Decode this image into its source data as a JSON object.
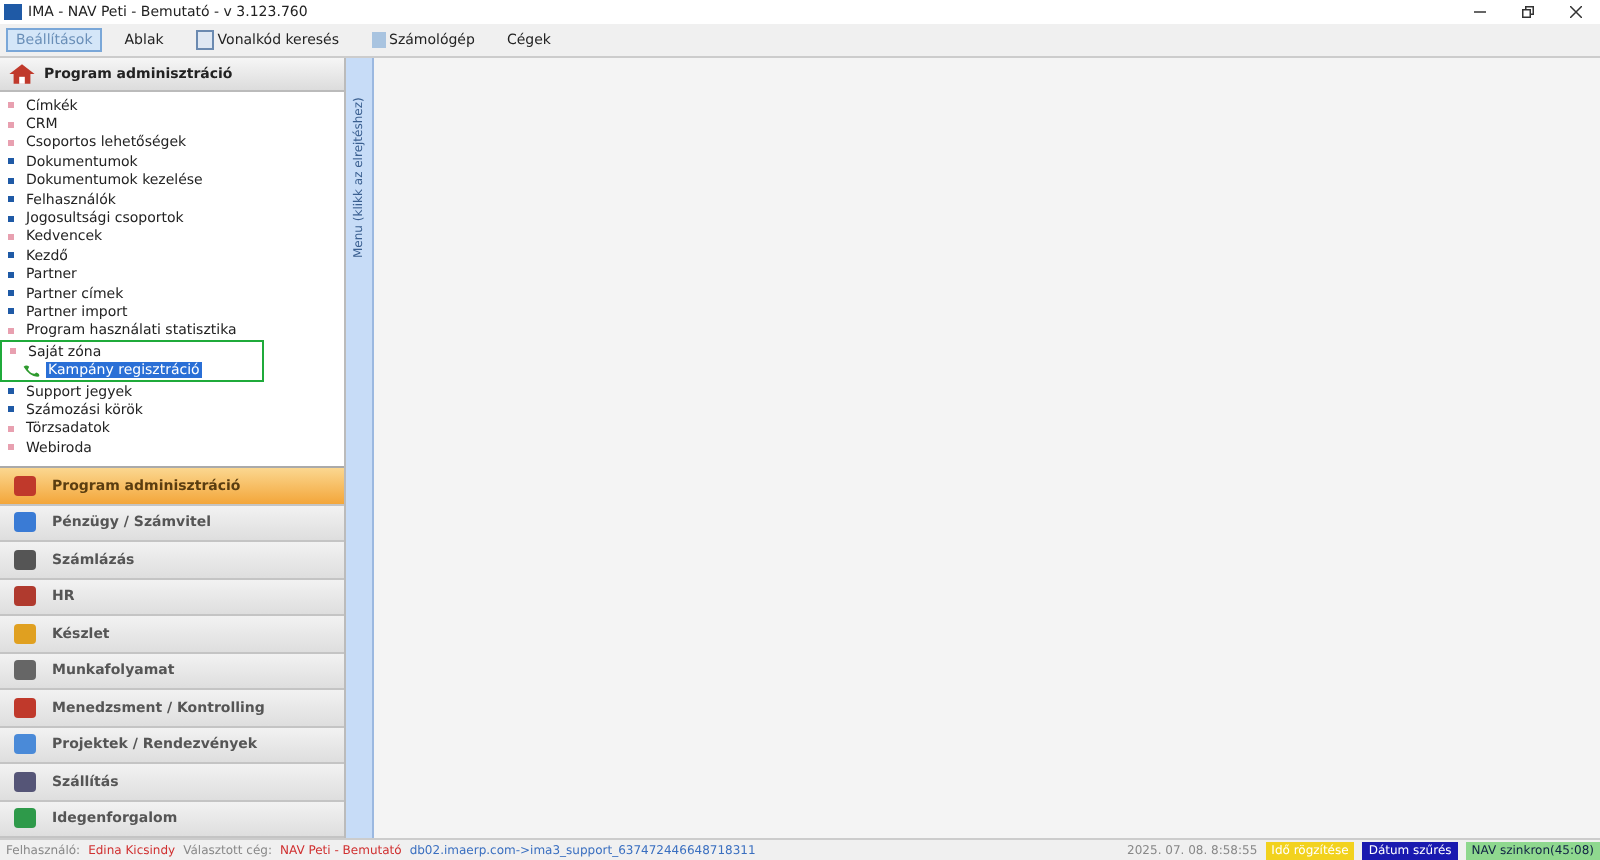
{
  "window": {
    "title": "IMA - NAV Peti - Bemutató - v 3.123.760"
  },
  "menu": [
    {
      "label": "Beállítások",
      "selected": true
    },
    {
      "label": "Ablak",
      "selected": false
    },
    {
      "label": "Vonalkód keresés",
      "selected": false
    },
    {
      "label": "Számológép",
      "selected": false
    },
    {
      "label": "Cégek",
      "selected": false
    }
  ],
  "panel": {
    "title": "Program adminisztráció",
    "collapse_label": "Menu (klikk az elrejtéshez)"
  },
  "tree": [
    {
      "label": "Címkék",
      "color": "#e8a0b0",
      "selected": false
    },
    {
      "label": "CRM",
      "color": "#e8a0b0",
      "selected": false
    },
    {
      "label": "Csoportos lehetőségek",
      "color": "#e8a0b0",
      "selected": false
    },
    {
      "label": "Dokumentumok",
      "color": "#1f5aa6",
      "selected": false
    },
    {
      "label": "Dokumentumok kezelése",
      "color": "#1f5aa6",
      "selected": false
    },
    {
      "label": "Felhasználók",
      "color": "#1f5aa6",
      "selected": false
    },
    {
      "label": "Jogosultsági csoportok",
      "color": "#1f5aa6",
      "selected": false
    },
    {
      "label": "Kedvencek",
      "color": "#e8a0b0",
      "selected": false
    },
    {
      "label": "Kezdő",
      "color": "#1f5aa6",
      "selected": false
    },
    {
      "label": "Partner",
      "color": "#1f5aa6",
      "selected": false
    },
    {
      "label": "Partner címek",
      "color": "#1f5aa6",
      "selected": false
    },
    {
      "label": "Partner import",
      "color": "#1f5aa6",
      "selected": false
    },
    {
      "label": "Program használati statisztika",
      "color": "#e8a0b0",
      "selected": false
    },
    {
      "label": "Saját zóna",
      "color": "#e8a0b0",
      "selected": false,
      "children": [
        {
          "label": "Kampány regisztráció",
          "selected": true
        }
      ]
    },
    {
      "label": "Support jegyek",
      "color": "#1f5aa6",
      "selected": false
    },
    {
      "label": "Számozási körök",
      "color": "#1f5aa6",
      "selected": false
    },
    {
      "label": "Törzsadatok",
      "color": "#e8a0b0",
      "selected": false
    },
    {
      "label": "Webiroda",
      "color": "#e8a0b0",
      "selected": false
    }
  ],
  "modules": [
    {
      "label": "Program adminisztráció",
      "selected": true
    },
    {
      "label": "Pénzügy / Számvitel",
      "selected": false
    },
    {
      "label": "Számlázás",
      "selected": false
    },
    {
      "label": "HR",
      "selected": false
    },
    {
      "label": "Készlet",
      "selected": false
    },
    {
      "label": "Munkafolyamat",
      "selected": false
    },
    {
      "label": "Menedzsment / Kontrolling",
      "selected": false
    },
    {
      "label": "Projektek / Rendezvények",
      "selected": false
    },
    {
      "label": "Szállítás",
      "selected": false
    },
    {
      "label": "Idegenforgalom",
      "selected": false
    }
  ],
  "status_bar": {
    "user_label": "Felhasználó:",
    "user": "Edina Kicsindy",
    "company_label": "Választott cég:",
    "company": "NAV Peti - Bemutató",
    "connection": "db02.imaerp.com->ima3_support_637472446648718311",
    "datetime": "2025. 07. 08. 8:58:55",
    "badges": [
      {
        "label": "Idő rögzítése",
        "kind": "time"
      },
      {
        "label": "Dátum szűrés",
        "kind": "date"
      },
      {
        "label": "NAV szinkron(45:08)",
        "kind": "nav"
      }
    ]
  }
}
